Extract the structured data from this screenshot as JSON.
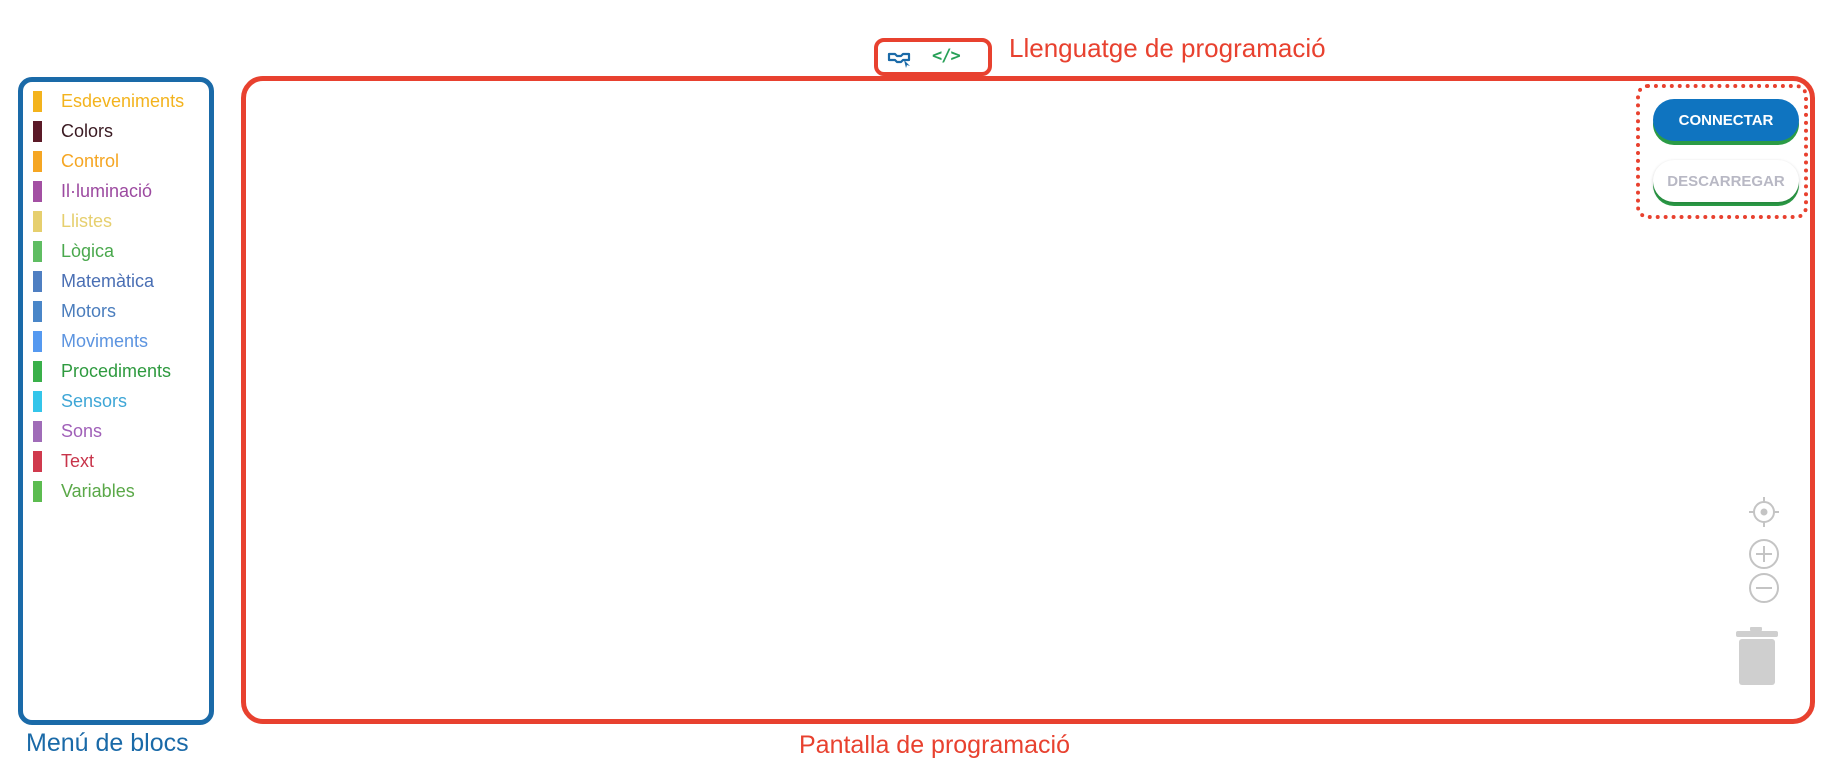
{
  "language_toggle": {
    "blocks_icon": "puzzle-blocks-icon",
    "code_glyph": "</>",
    "caption": "Llenguatge de programació"
  },
  "block_menu": {
    "caption": "Menú de blocs",
    "items": [
      {
        "label": "Esdeveniments",
        "color": "#f3b31d",
        "text_color": "#f3b31d"
      },
      {
        "label": "Colors",
        "color": "#5b1a28",
        "text_color": "#3a1a22"
      },
      {
        "label": "Control",
        "color": "#f5a623",
        "text_color": "#f5a623"
      },
      {
        "label": "Il·luminació",
        "color": "#a350a3",
        "text_color": "#9c4aa0"
      },
      {
        "label": "Llistes",
        "color": "#e6cf6e",
        "text_color": "#e6cf6e"
      },
      {
        "label": "Lògica",
        "color": "#5fbd62",
        "text_color": "#4aa84d"
      },
      {
        "label": "Matemàtica",
        "color": "#4f7fc2",
        "text_color": "#4a6fb4"
      },
      {
        "label": "Motors",
        "color": "#4a86c8",
        "text_color": "#4a7dbd"
      },
      {
        "label": "Moviments",
        "color": "#5599f0",
        "text_color": "#5c94e0"
      },
      {
        "label": "Procediments",
        "color": "#3ab04a",
        "text_color": "#2e9a3f"
      },
      {
        "label": "Sensors",
        "color": "#34c5ea",
        "text_color": "#3ea6d6"
      },
      {
        "label": "Sons",
        "color": "#a06cb8",
        "text_color": "#a060b8"
      },
      {
        "label": "Text",
        "color": "#d03a4d",
        "text_color": "#c8344a"
      },
      {
        "label": "Variables",
        "color": "#5cbc50",
        "text_color": "#5aa848"
      }
    ]
  },
  "canvas": {
    "caption": "Pantalla de programació",
    "connect_label": "CONNECTAR",
    "download_label": "DESCARREGAR",
    "tools": {
      "center": "target-center-icon",
      "zoom_in": "zoom-in-icon",
      "zoom_out": "zoom-out-icon",
      "trash": "trash-icon"
    }
  },
  "colors": {
    "annotation_red": "#e8412f",
    "annotation_blue": "#1a6aa8",
    "connect_blue": "#0f74c0",
    "button_shadow_green": "#2b9b46"
  }
}
